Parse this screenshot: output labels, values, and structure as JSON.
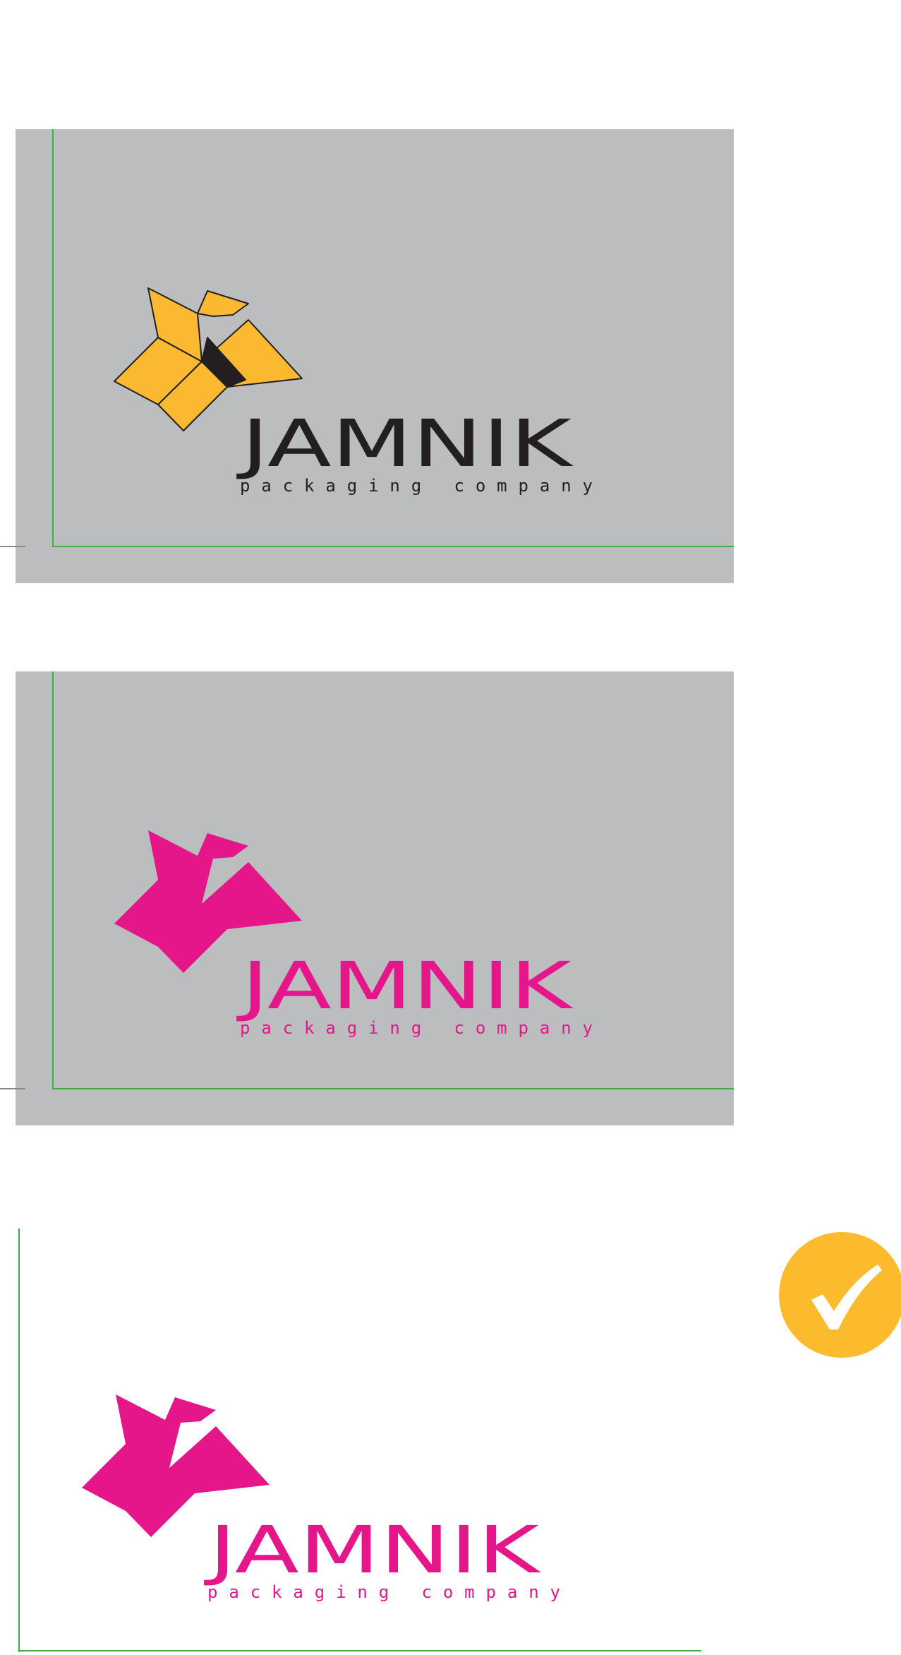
{
  "colors": {
    "panel_grey": "#bcbdbf",
    "guide_green": "#3fae49",
    "crop_mark": "#8a8a8a",
    "brand_yellow": "#fbb931",
    "brand_dark": "#231f20",
    "brand_magenta": "#e5168a",
    "check_badge": "#fbbb2d"
  },
  "variants": [
    {
      "background": "grey",
      "logo_style": "full-color",
      "wordmark": "JAMNIK",
      "tagline": "packaging company"
    },
    {
      "background": "grey",
      "logo_style": "magenta",
      "wordmark": "JAMNIK",
      "tagline": "packaging company"
    },
    {
      "background": "white",
      "logo_style": "magenta",
      "wordmark": "JAMNIK",
      "tagline": "packaging company"
    }
  ],
  "approved_badge": {
    "icon": "checkmark-icon",
    "marks_variant": 3
  }
}
